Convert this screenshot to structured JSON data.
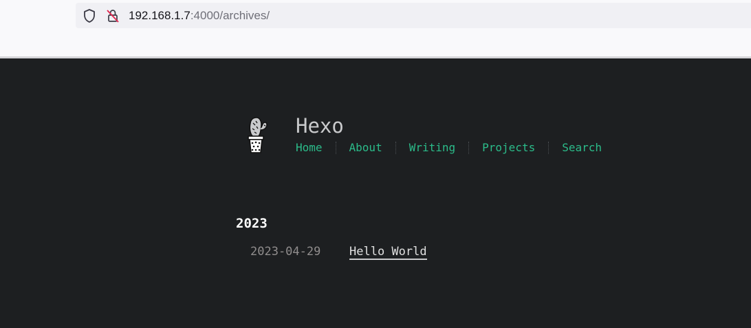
{
  "browser": {
    "url_host": "192.168.1.7",
    "url_rest": ":4000/archives/"
  },
  "site": {
    "title": "Hexo",
    "nav": [
      "Home",
      "About",
      "Writing",
      "Projects",
      "Search"
    ]
  },
  "archive": {
    "year": "2023",
    "posts": [
      {
        "date": "2023-04-29",
        "title": "Hello World"
      }
    ]
  },
  "icons": {
    "shield": "shield-icon",
    "lock": "insecure-lock-icon",
    "logo": "cactus-logo-icon"
  }
}
